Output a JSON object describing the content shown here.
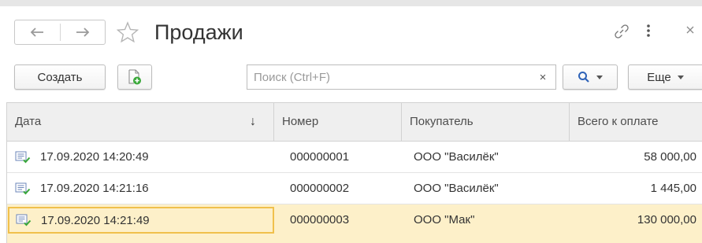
{
  "window": {
    "title": "Продажи"
  },
  "toolbar": {
    "create_label": "Создать",
    "search_placeholder": "Поиск (Ctrl+F)",
    "search_value": "",
    "clear_glyph": "×",
    "more_label": "Еще"
  },
  "icons": {
    "back": "arrow-left-icon",
    "forward": "arrow-right-icon",
    "favorite": "star-icon",
    "link": "link-icon",
    "menu": "more-vertical-icon",
    "close": "close-icon",
    "copy": "document-add-icon",
    "search": "search-icon",
    "row": "posted-document-icon"
  },
  "table": {
    "columns": [
      "Дата",
      "Номер",
      "Покупатель",
      "Всего к оплате"
    ],
    "sort_indicator": "↓",
    "rows": [
      {
        "date": "17.09.2020 14:20:49",
        "number": "000000001",
        "customer": "ООО \"Василёк\"",
        "total": "58 000,00"
      },
      {
        "date": "17.09.2020 14:21:16",
        "number": "000000002",
        "customer": "ООО \"Василёк\"",
        "total": "1 445,00"
      },
      {
        "date": "17.09.2020 14:21:49",
        "number": "000000003",
        "customer": "ООО \"Мак\"",
        "total": "130 000,00"
      }
    ],
    "selected_row": 2
  },
  "colors": {
    "selected_row_bg": "#fdf0c9",
    "selected_cell_border": "#f0c04c",
    "header_bg": "#efefef",
    "accent_icon": "#2f63b8",
    "posted_check": "#3aa83a"
  }
}
